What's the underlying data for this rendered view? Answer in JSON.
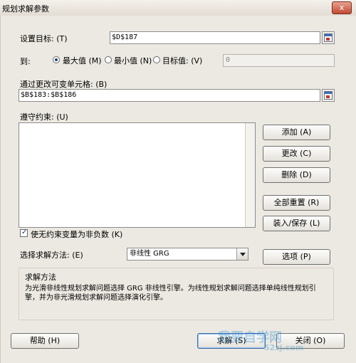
{
  "window": {
    "title": "规划求解参数",
    "close_label": "x"
  },
  "target": {
    "label": "设置目标: (T)",
    "value": "$D$187"
  },
  "to": {
    "label": "到:",
    "options": [
      {
        "label": "最大值 (M)",
        "checked": true
      },
      {
        "label": "最小值 (N)",
        "checked": false
      },
      {
        "label": "目标值: (V)",
        "checked": false
      }
    ],
    "value_field": "0"
  },
  "changing_cells": {
    "label": "通过更改可变单元格: (B)",
    "value": "$B$183:$B$186"
  },
  "constraints": {
    "label": "遵守约束: (U)"
  },
  "side_buttons": {
    "add": "添加 (A)",
    "change": "更改 (C)",
    "delete": "删除 (D)",
    "reset_all": "全部重置 (R)",
    "load_save": "装入/保存 (L)"
  },
  "nonneg": {
    "label": "使无约束变量为非负数 (K)",
    "checked": true
  },
  "method": {
    "label": "选择求解方法: (E)",
    "selected": "非线性 GRG",
    "options_button": "选项 (P)"
  },
  "solving_method": {
    "title": "求解方法",
    "description_line1": "为光滑非线性规划求解问题选择 GRG 非线性引擎。为线性规划求解问题选择单纯线性规划引",
    "description_line2": "擎，并为非光滑规划求解问题选择演化引擎。"
  },
  "bottom": {
    "help": "帮助 (H)",
    "solve": "求解 (S)",
    "close": "关闭 (O)"
  },
  "watermark": {
    "text": "我要自学网",
    "url": "52zj.com"
  }
}
